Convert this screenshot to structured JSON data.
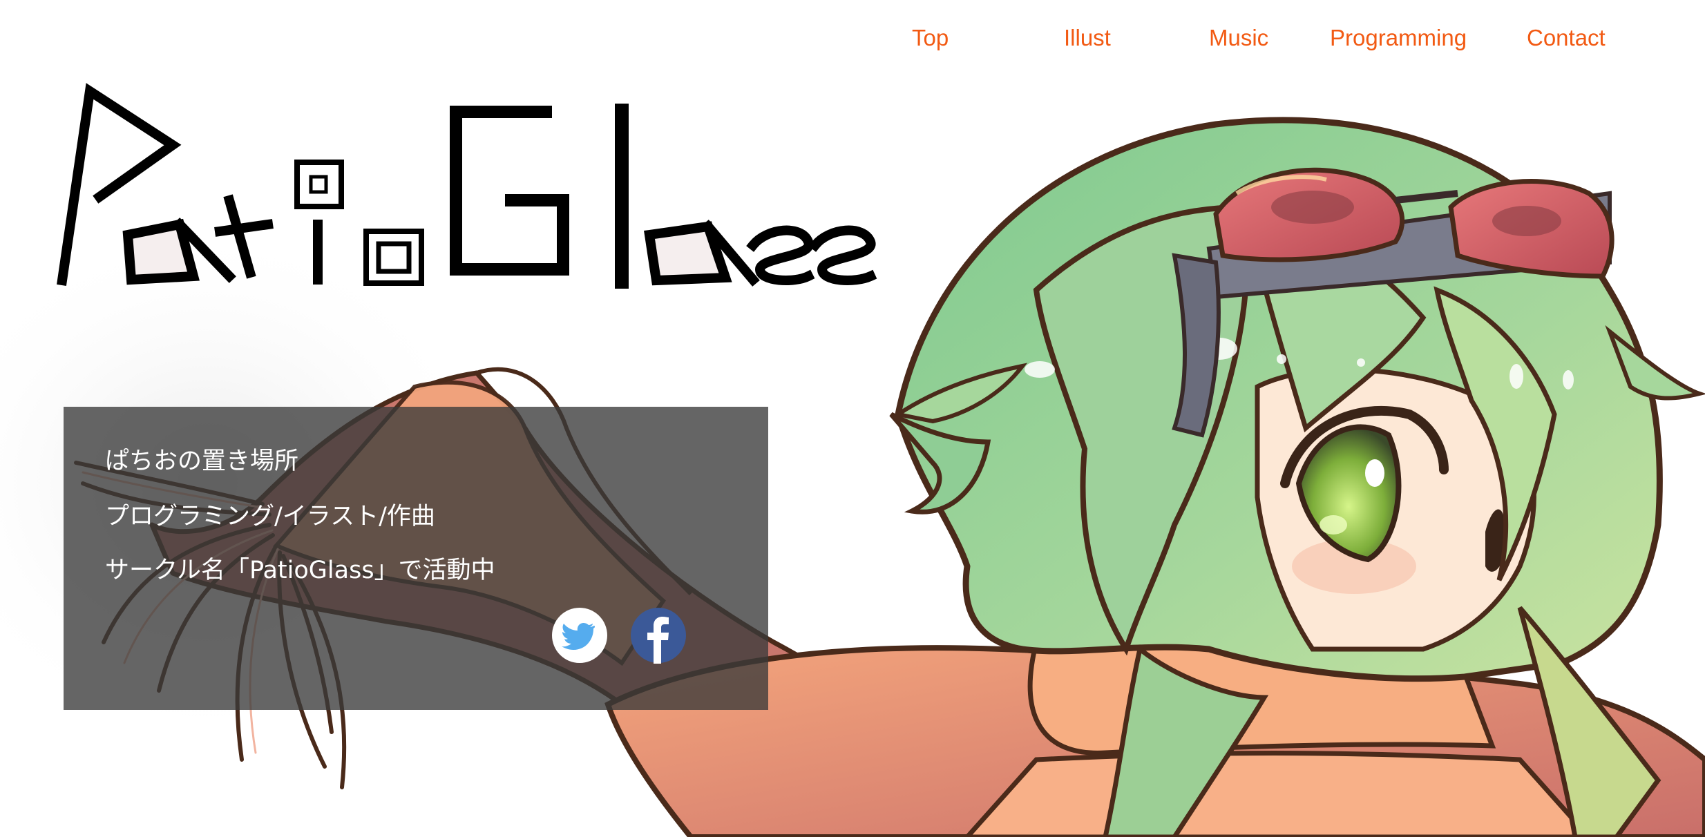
{
  "nav": {
    "items": [
      {
        "label": "Top"
      },
      {
        "label": "Illust"
      },
      {
        "label": "Music"
      },
      {
        "label": "Programming"
      },
      {
        "label": "Contact"
      }
    ]
  },
  "brand": {
    "logo_text": "PatioGlass"
  },
  "intro": {
    "lines": [
      "ぱちおの置き場所",
      "プログラミング/イラスト/作曲",
      "サークル名「PatioGlass」で活動中"
    ]
  },
  "social": {
    "twitter_icon": "twitter-bird-icon",
    "facebook_icon": "facebook-f-icon"
  },
  "colors": {
    "nav_link": "#f25a13",
    "panel_bg": "#3a3a3a",
    "twitter_blue": "#55acee",
    "facebook_blue": "#3b5998",
    "hair_green": "#9fd39a",
    "outline_brown": "#4a2a1a"
  }
}
